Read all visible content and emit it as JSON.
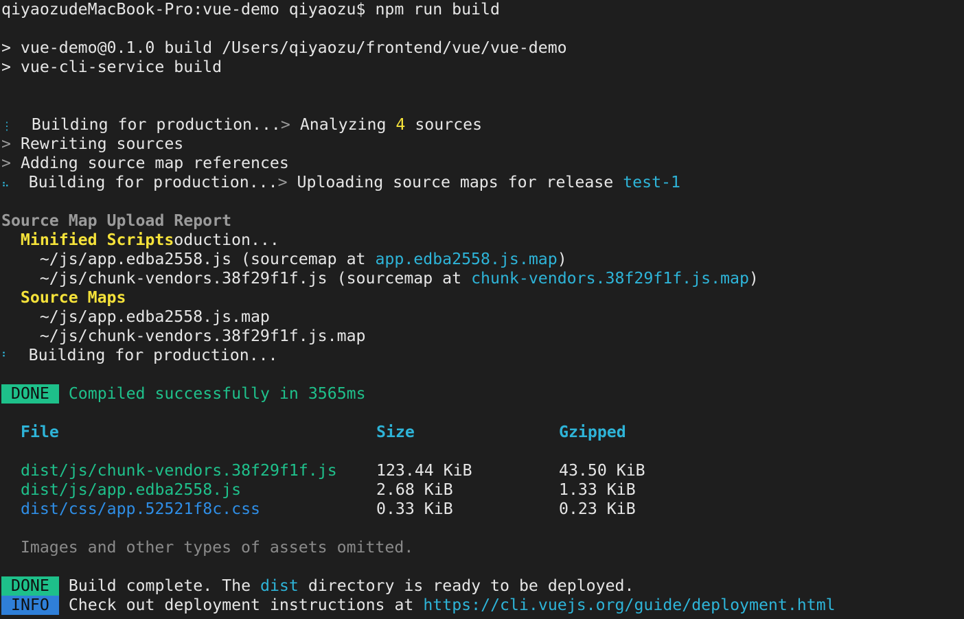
{
  "prompt": {
    "host": "qiyaozudeMacBook-Pro:vue-demo qiyaozu$",
    "command": "npm run build"
  },
  "npm_output": {
    "script_line": "> vue-demo@0.1.0 build /Users/qiyaozu/frontend/vue/vue-demo",
    "service_line": "> vue-cli-service build"
  },
  "build_progress": {
    "spinner_1": "⋮",
    "building_label": "Building for production...",
    "analyzing_prefix": "> Analyzing ",
    "analyzing_count": "4",
    "analyzing_suffix": " sources",
    "rewriting": "Rewriting sources",
    "adding_maps": "Adding source map references",
    "spinner_2": "⠦",
    "uploading_prefix": "> Uploading source maps for release ",
    "release_name": "test-1",
    "gt": ">"
  },
  "report": {
    "title": "Source Map Upload Report",
    "minified_heading": "Minified Scripts",
    "minified_overlap": "oduction...",
    "minified": [
      {
        "file": "~/js/app.edba2558.js",
        "sourcemap": "app.edba2558.js.map"
      },
      {
        "file": "~/js/chunk-vendors.38f29f1f.js",
        "sourcemap": "chunk-vendors.38f29f1f.js.map"
      }
    ],
    "sourcemap_prefix": " (sourcemap at ",
    "sourcemap_suffix": ")",
    "maps_heading": "Source Maps",
    "maps": [
      "~/js/app.edba2558.js.map",
      "~/js/chunk-vendors.38f29f1f.js.map"
    ],
    "spinner_3": "⠃",
    "building_label": "Building for production..."
  },
  "compiled": {
    "badge": "DONE",
    "message": "Compiled successfully in 3565ms"
  },
  "files_table": {
    "headers": {
      "file": "File",
      "size": "Size",
      "gzipped": "Gzipped"
    },
    "rows": [
      {
        "file": "dist/js/chunk-vendors.38f29f1f.js",
        "size": "123.44 KiB",
        "gzipped": "43.50 KiB",
        "kind": "js"
      },
      {
        "file": "dist/js/app.edba2558.js",
        "size": "2.68 KiB",
        "gzipped": "1.33 KiB",
        "kind": "js"
      },
      {
        "file": "dist/css/app.52521f8c.css",
        "size": "0.33 KiB",
        "gzipped": "0.23 KiB",
        "kind": "css"
      }
    ],
    "omitted_note": "Images and other types of assets omitted."
  },
  "footer": {
    "done_badge": "DONE",
    "done_prefix": "Build complete. The ",
    "done_dir": "dist",
    "done_suffix": " directory is ready to be deployed.",
    "info_badge": "INFO",
    "info_prefix": "Check out deployment instructions at ",
    "info_url": "https://cli.vuejs.org/guide/deployment.html"
  },
  "colors": {
    "background": "#1e1e1e",
    "text": "#e6e6e6",
    "success_green": "#1fc08b",
    "link_cyan": "#2eb4d8",
    "css_blue": "#2f8ee6",
    "heading_yellow": "#f5e23a",
    "done_badge": "#1ec08a",
    "info_badge": "#2f7fd8"
  }
}
